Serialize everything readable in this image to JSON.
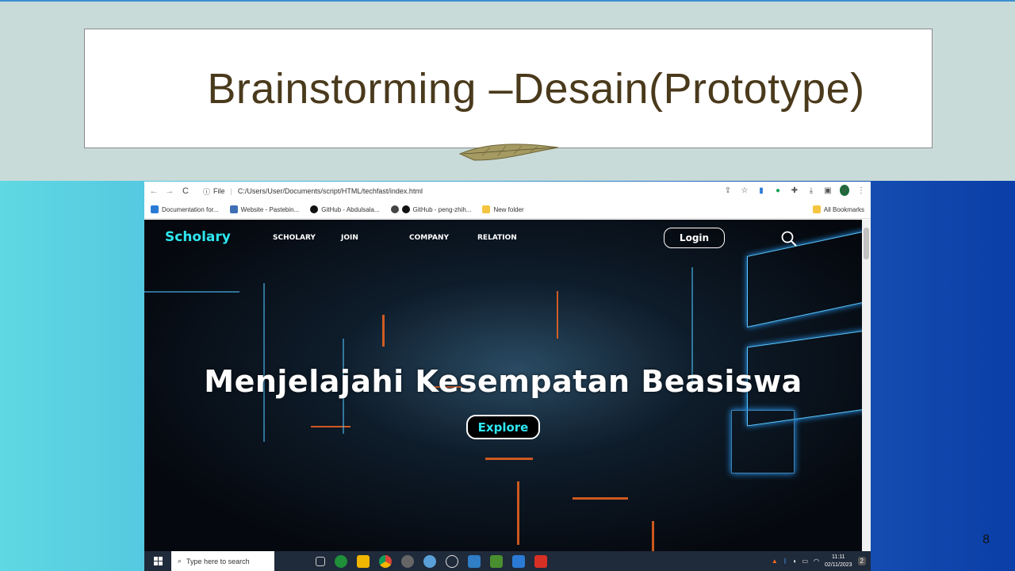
{
  "slide": {
    "title": "Brainstorming –Desain(Prototype)",
    "page_number": "8"
  },
  "browser": {
    "url_scheme_label": "File",
    "url": "C:/Users/User/Documents/script/HTML/techfast/index.html",
    "profile_initial": "V",
    "bookmarks": [
      {
        "label": "Documentation for...",
        "icon": "vscode-icon",
        "color": "#2b7bd6"
      },
      {
        "label": "Website - Pastebin...",
        "icon": "pastebin-icon",
        "color": "#3f6fb5"
      },
      {
        "label": "GitHub - Abdulsala...",
        "icon": "github-icon",
        "color": "#111111"
      },
      {
        "label": "GitHub - peng-zhih...",
        "icon": "github-icon",
        "color": "#111111"
      },
      {
        "label": "New folder",
        "icon": "folder-icon",
        "color": "#f5c542"
      }
    ],
    "all_bookmarks_label": "All Bookmarks"
  },
  "site": {
    "logo": "Scholary",
    "nav": [
      "SCHOLARY",
      "JOIN",
      "COMPANY",
      "RELATION"
    ],
    "login_label": "Login",
    "hero_heading": "Menjelajahi Kesempatan Beasiswa",
    "explore_label": "Explore"
  },
  "taskbar": {
    "search_placeholder": "Type here to search",
    "time": "11:11",
    "date": "02/11/2023",
    "notification_count": "2",
    "app_colors": [
      "#1f8f3a",
      "#f2b600",
      "#db4437",
      "#666666",
      "#5aa0d8",
      "#e0e0e0",
      "#2f7ec6",
      "#4a8f2f",
      "#2b7bd6",
      "#d93025"
    ]
  }
}
